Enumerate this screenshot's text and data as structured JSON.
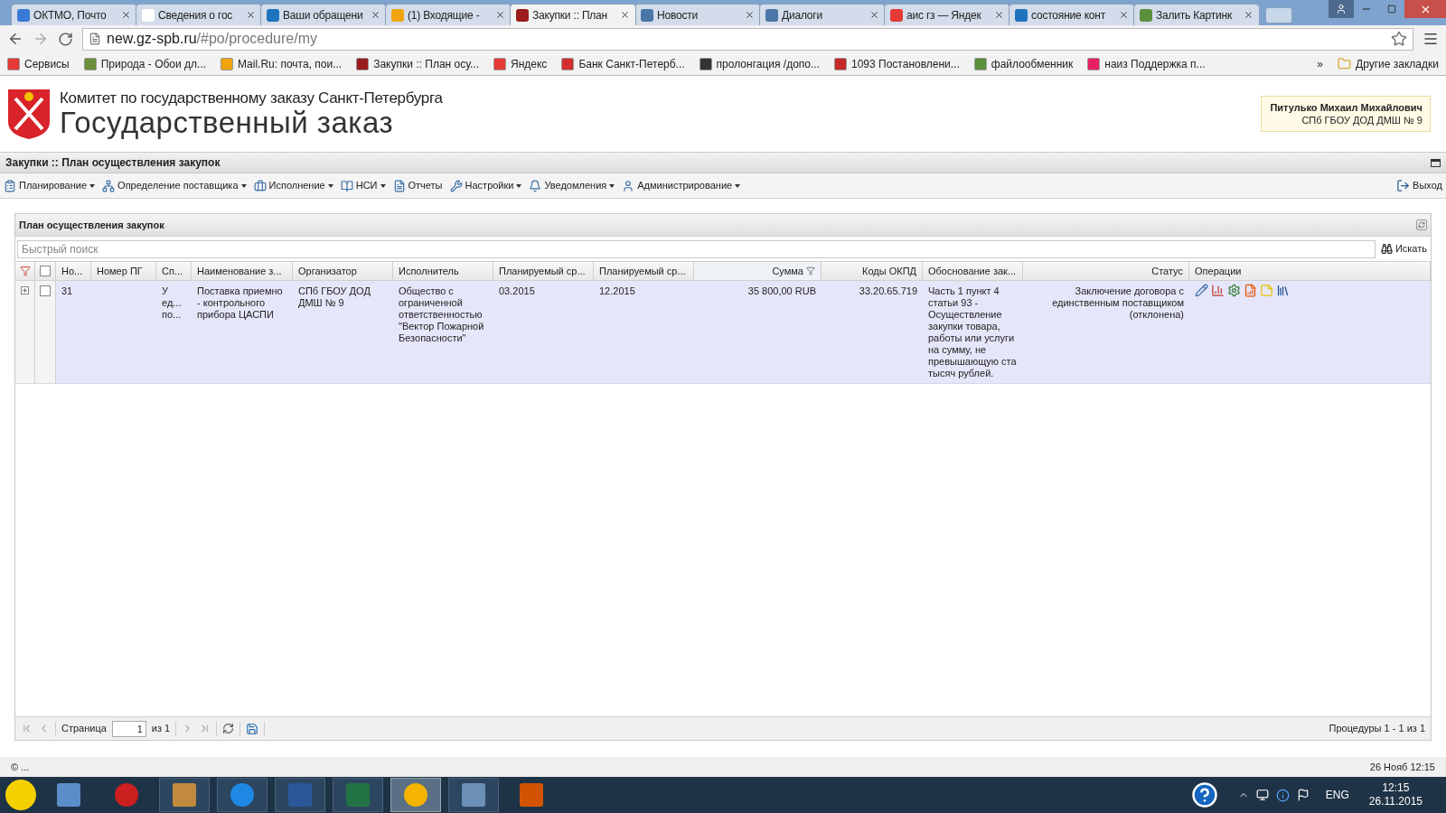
{
  "browser_tabs": [
    {
      "title": "ОКТМО, Почто",
      "selected": false,
      "color": "#3a7bd5"
    },
    {
      "title": "Сведения о гос",
      "selected": false,
      "color": "#ffffff"
    },
    {
      "title": "Ваши обращени",
      "selected": false,
      "color": "#1e73be"
    },
    {
      "title": "(1) Входящие -",
      "selected": false,
      "color": "#f0a30a"
    },
    {
      "title": "Закупки :: План",
      "selected": true,
      "color": "#9b1c1c"
    },
    {
      "title": "Новости",
      "selected": false,
      "color": "#4a76a8"
    },
    {
      "title": "Диалоги",
      "selected": false,
      "color": "#4a76a8"
    },
    {
      "title": "аис гз — Яндек",
      "selected": false,
      "color": "#e53935"
    },
    {
      "title": "состояние конт",
      "selected": false,
      "color": "#1e73be"
    },
    {
      "title": "Залить Картинк",
      "selected": false,
      "color": "#5a8f3c"
    }
  ],
  "address": {
    "host": "new.gz-spb.ru",
    "path": "/#po/procedure/my"
  },
  "bookmarks": [
    {
      "label": "Сервисы",
      "color": "#e53935"
    },
    {
      "label": "Природа - Обои дл...",
      "color": "#6d8f3c"
    },
    {
      "label": "Mail.Ru: почта, пои...",
      "color": "#f0a30a"
    },
    {
      "label": "Закупки :: План осу...",
      "color": "#9b1c1c"
    },
    {
      "label": "Яндекс",
      "color": "#e53935"
    },
    {
      "label": "Банк Санкт-Петерб...",
      "color": "#d32f2f"
    },
    {
      "label": "пролонгация /допо...",
      "color": "#333333"
    },
    {
      "label": "1093 Постановлени...",
      "color": "#c62828"
    },
    {
      "label": "файлообменник",
      "color": "#5a8f3c"
    },
    {
      "label": "наиз Поддержка п...",
      "color": "#e91e63"
    }
  ],
  "bookmarks_more": "»",
  "other_bookmarks": "Другие закладки",
  "header": {
    "org": "Комитет по государственному заказу Санкт-Петербурга",
    "title": "Государственный заказ",
    "user_name": "Питулько Михаил Михайлович",
    "user_org": "СПб ГБОУ ДОД ДМШ № 9"
  },
  "section_title": "Закупки :: План осуществления закупок",
  "menu": [
    {
      "label": "Планирование",
      "dropdown": true
    },
    {
      "label": "Определение поставщика",
      "dropdown": true
    },
    {
      "label": "Исполнение",
      "dropdown": true
    },
    {
      "label": "НСИ",
      "dropdown": true
    },
    {
      "label": "Отчеты",
      "dropdown": false
    },
    {
      "label": "Настройки",
      "dropdown": true
    },
    {
      "label": "Уведомления",
      "dropdown": true
    },
    {
      "label": "Администрирование",
      "dropdown": true
    }
  ],
  "logout": "Выход",
  "grid": {
    "title": "План осуществления закупок",
    "search_placeholder": "Быстрый поиск",
    "search_button": "Искать",
    "all_checked": false,
    "columns": [
      {
        "label": "Но...",
        "filtered": false
      },
      {
        "label": "Номер ПГ",
        "filtered": false
      },
      {
        "label": "Сп...",
        "filtered": false
      },
      {
        "label": "Наименование з...",
        "filtered": false
      },
      {
        "label": "Организатор",
        "filtered": false
      },
      {
        "label": "Исполнитель",
        "filtered": false
      },
      {
        "label": "Планируемый ср...",
        "filtered": false
      },
      {
        "label": "Планируемый ср...",
        "filtered": false
      },
      {
        "label": "Сумма",
        "filtered": true
      },
      {
        "label": "Коды ОКПД",
        "filtered": false
      },
      {
        "label": "Обоснование зак...",
        "filtered": false
      },
      {
        "label": "Статус",
        "filtered": false
      },
      {
        "label": "Операции",
        "filtered": false
      }
    ],
    "rows": [
      {
        "expanded": false,
        "checked": false,
        "selected": true,
        "cells": [
          "31",
          "",
          "У\nед...\nпо...",
          "Поставка приемно - контрольного прибора ЦАСПИ",
          "СПб ГБОУ ДОД ДМШ № 9",
          "Общество с ограниченной ответственностью \"Вектор Пожарной Безопасности\"",
          "03.2015",
          "12.2015",
          "35 800,00 RUB",
          "33.20.65.719",
          "Часть 1 пункт 4 статьи 93 - Осуществление закупки товара, работы или услуги на сумму, не превышающую ста тысяч рублей.",
          "Заключение договора с единственным поставщиком (отклонена)"
        ]
      }
    ],
    "pager": {
      "page_label": "Страница",
      "page": "1",
      "of": "из 1",
      "summary": "Процедуры 1 - 1 из 1"
    }
  },
  "status_bar": {
    "left": "© ...",
    "right": "26 Нояб 12:15"
  },
  "taskbar": {
    "language": "ENG",
    "time": "12:15",
    "date": "26.11.2015"
  }
}
